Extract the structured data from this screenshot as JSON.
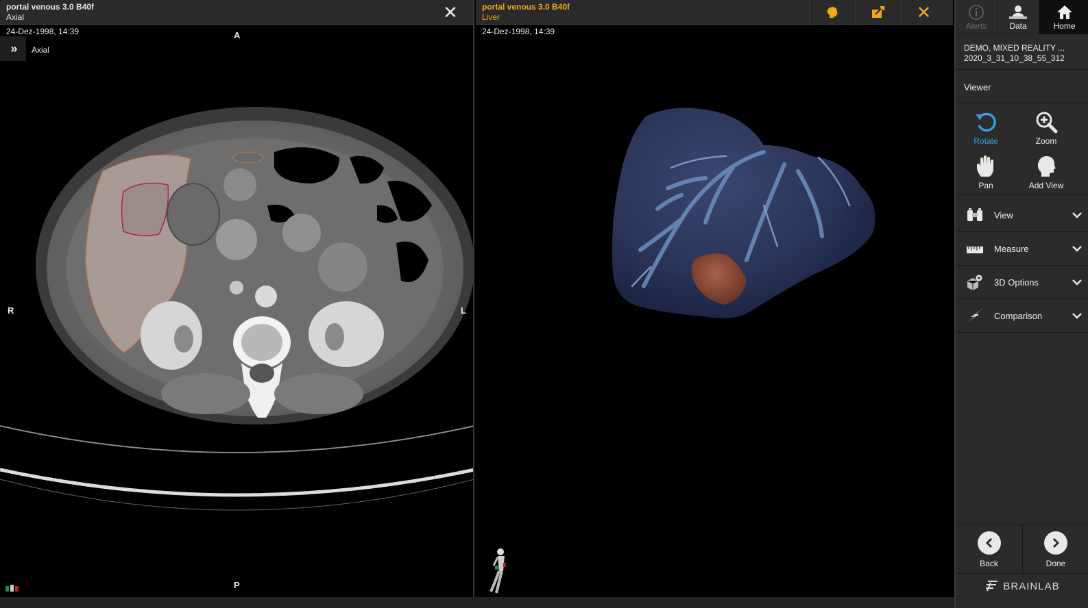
{
  "left_viewport": {
    "title": "portal venous 3.0 B40f",
    "subtitle": "Axial",
    "datetime": "24-Dez-1998, 14:39",
    "view_label": "Axial",
    "orientation": {
      "top": "A",
      "bottom": "P",
      "left": "R",
      "right": "L"
    }
  },
  "right_viewport": {
    "title": "portal venous 3.0 B40f",
    "subtitle": "Liver",
    "datetime": "24-Dez-1998, 14:39"
  },
  "nav": {
    "alerts": "Alerts",
    "data": "Data",
    "home": "Home"
  },
  "patient": {
    "name": "DEMO, MIXED REALITY ...",
    "id": "2020_3_31_10_38_55_312"
  },
  "viewer": {
    "title": "Viewer",
    "tools": {
      "rotate": "Rotate",
      "zoom": "Zoom",
      "pan": "Pan",
      "add_view": "Add View"
    }
  },
  "accordion": {
    "view": "View",
    "measure": "Measure",
    "options_3d": "3D Options",
    "comparison": "Comparison"
  },
  "bottom": {
    "back": "Back",
    "done": "Done"
  },
  "brand": "BRAINLAB",
  "colors": {
    "accent_orange": "#f2a81d",
    "active_blue": "#3a9ce0",
    "panel_bg": "#2b2b2b",
    "liver_blue": "#2b3558",
    "tumor": "#8a4a35",
    "contour_orange": "#c07a4a",
    "contour_magenta": "#b0205a"
  }
}
